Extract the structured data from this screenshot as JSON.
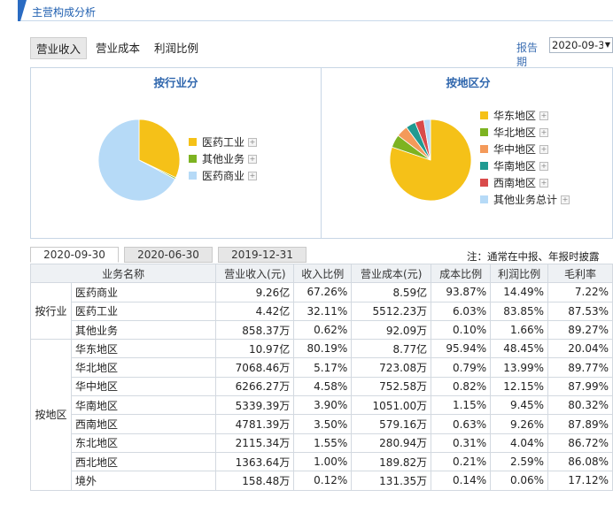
{
  "header": {
    "title": "主营构成分析"
  },
  "tabs": [
    {
      "label": "营业收入",
      "active": true
    },
    {
      "label": "营业成本",
      "active": false
    },
    {
      "label": "利润比例",
      "active": false
    }
  ],
  "period": {
    "label": "报告期",
    "value": "2020-09-3"
  },
  "panels": {
    "left_title": "按行业分",
    "right_title": "按地区分"
  },
  "chart_data": [
    {
      "type": "pie",
      "title": "按行业分",
      "categories": [
        "医药工业",
        "其他业务",
        "医药商业"
      ],
      "values": [
        32.11,
        0.62,
        67.26
      ],
      "colors": [
        "#f5c118",
        "#7db321",
        "#b6daf7"
      ],
      "legend_placement": "right"
    },
    {
      "type": "pie",
      "title": "按地区分",
      "categories": [
        "华东地区",
        "华北地区",
        "华中地区",
        "华南地区",
        "西南地区",
        "其他业务总计"
      ],
      "values": [
        80.19,
        5.17,
        4.58,
        3.9,
        3.5,
        2.67
      ],
      "colors": [
        "#f5c118",
        "#7db321",
        "#f49a5a",
        "#1f9a91",
        "#d94a4a",
        "#b6daf7"
      ],
      "legend_placement": "right"
    }
  ],
  "date_tabs": [
    {
      "label": "2020-09-30",
      "active": true
    },
    {
      "label": "2020-06-30",
      "active": false
    },
    {
      "label": "2019-12-31",
      "active": false
    }
  ],
  "note": "注：通常在中报、年报时披露",
  "table": {
    "headers": [
      "业务名称",
      "营业收入(元)",
      "收入比例",
      "营业成本(元)",
      "成本比例",
      "利润比例",
      "毛利率"
    ],
    "groups": [
      {
        "name": "按行业",
        "rows": [
          [
            "医药商业",
            "9.26亿",
            "67.26%",
            "8.59亿",
            "93.87%",
            "14.49%",
            "7.22%"
          ],
          [
            "医药工业",
            "4.42亿",
            "32.11%",
            "5512.23万",
            "6.03%",
            "83.85%",
            "87.53%"
          ],
          [
            "其他业务",
            "858.37万",
            "0.62%",
            "92.09万",
            "0.10%",
            "1.66%",
            "89.27%"
          ]
        ]
      },
      {
        "name": "按地区",
        "rows": [
          [
            "华东地区",
            "10.97亿",
            "80.19%",
            "8.77亿",
            "95.94%",
            "48.45%",
            "20.04%"
          ],
          [
            "华北地区",
            "7068.46万",
            "5.17%",
            "723.08万",
            "0.79%",
            "13.99%",
            "89.77%"
          ],
          [
            "华中地区",
            "6266.27万",
            "4.58%",
            "752.58万",
            "0.82%",
            "12.15%",
            "87.99%"
          ],
          [
            "华南地区",
            "5339.39万",
            "3.90%",
            "1051.00万",
            "1.15%",
            "9.45%",
            "80.32%"
          ],
          [
            "西南地区",
            "4781.39万",
            "3.50%",
            "579.16万",
            "0.63%",
            "9.26%",
            "87.89%"
          ],
          [
            "东北地区",
            "2115.34万",
            "1.55%",
            "280.94万",
            "0.31%",
            "4.04%",
            "86.72%"
          ],
          [
            "西北地区",
            "1363.64万",
            "1.00%",
            "189.82万",
            "0.21%",
            "2.59%",
            "86.08%"
          ],
          [
            "境外",
            "158.48万",
            "0.12%",
            "131.35万",
            "0.14%",
            "0.06%",
            "17.12%"
          ]
        ]
      }
    ]
  }
}
